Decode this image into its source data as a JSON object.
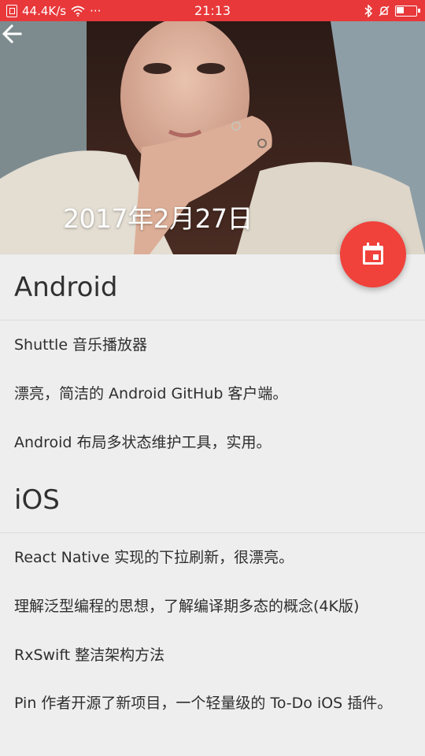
{
  "status_bar": {
    "net_speed": "44.4K/s",
    "more": "···",
    "time": "21:13"
  },
  "header": {
    "title": "2017年2月27日"
  },
  "colors": {
    "status_bar": "#e8383a",
    "fab": "#f0413b",
    "background": "#eeeeee"
  },
  "sections": [
    {
      "title": "Android",
      "items": [
        "Shuttle 音乐播放器",
        "漂亮，简洁的 Android GitHub 客户端。",
        "Android 布局多状态维护工具，实用。"
      ]
    },
    {
      "title": "iOS",
      "items": [
        "React Native 实现的下拉刷新，很漂亮。",
        "理解泛型编程的思想，了解编译期多态的概念(4K版)",
        "RxSwift 整洁架构方法",
        "Pin 作者开源了新项目，一个轻量级的 To-Do iOS 插件。"
      ]
    }
  ]
}
